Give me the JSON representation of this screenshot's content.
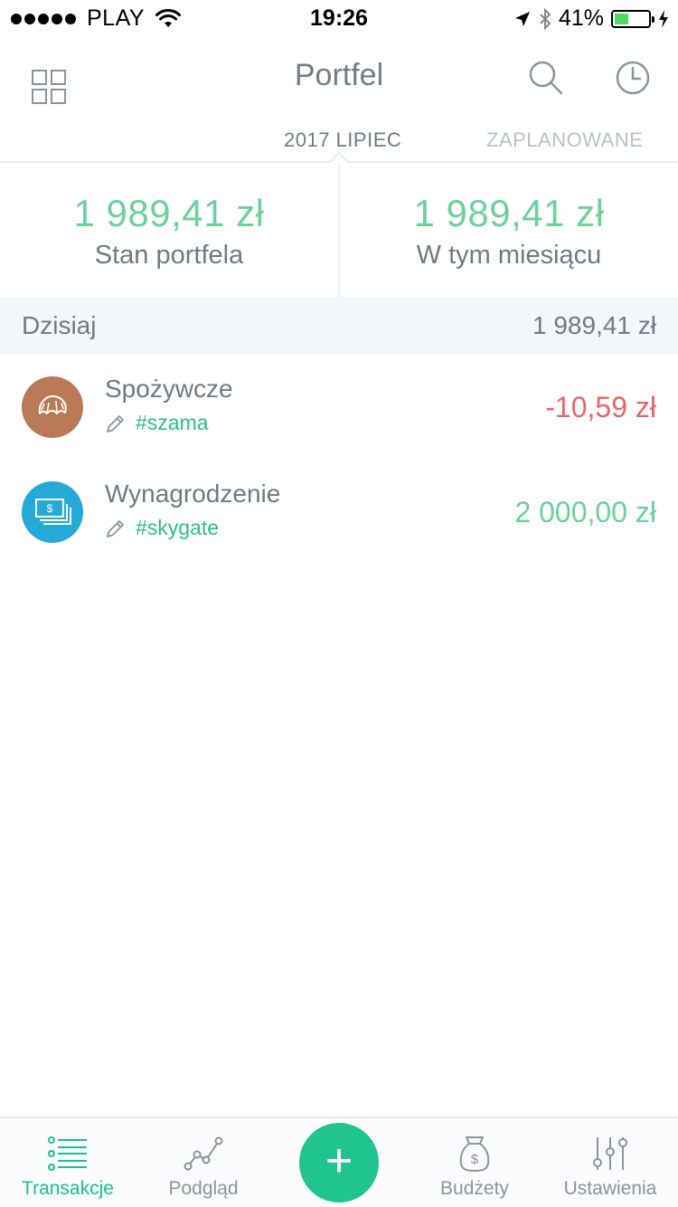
{
  "status_bar": {
    "carrier": "PLAY",
    "time": "19:26",
    "battery_percent": "41%",
    "battery_level": 0.41
  },
  "nav": {
    "title": "Portfel",
    "icons": [
      "grid-icon",
      "search-icon",
      "clock-icon"
    ]
  },
  "tabs": {
    "active": "2017 LIPIEC",
    "inactive": "ZAPLANOWANE"
  },
  "summary": {
    "balance_amount": "1 989,41 zł",
    "balance_label": "Stan portfela",
    "month_amount": "1 989,41 zł",
    "month_label": "W tym miesiącu"
  },
  "day": {
    "label": "Dzisiaj",
    "total": "1 989,41 zł"
  },
  "transactions": [
    {
      "name": "Spożywcze",
      "tag": "#szama",
      "amount": "-10,59 zł",
      "icon": "croissant-icon",
      "icon_color": "#b97a55"
    },
    {
      "name": "Wynagrodzenie",
      "tag": "#skygate",
      "amount": "2 000,00 zł",
      "icon": "banknotes-icon",
      "icon_color": "#25a9d6"
    }
  ],
  "tab_bar": {
    "items": [
      {
        "label": "Transakcje",
        "icon": "list-icon",
        "active": true
      },
      {
        "label": "Podgląd",
        "icon": "line-chart-icon",
        "active": false
      },
      {
        "label": "Budżety",
        "icon": "money-bag-icon",
        "active": false
      },
      {
        "label": "Ustawienia",
        "icon": "sliders-icon",
        "active": false
      }
    ],
    "add_button": "+"
  },
  "colors": {
    "accent": "#1fc48e",
    "positive": "#6ed09a",
    "negative": "#e9666b",
    "tag": "#2dbf86",
    "text": "#6f7a85"
  }
}
